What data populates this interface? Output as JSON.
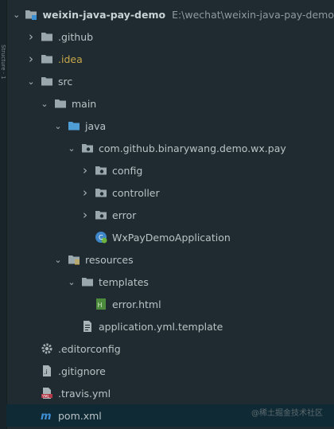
{
  "sidebar": {
    "text": "Structure · 1"
  },
  "tree": [
    {
      "label": "weixin-java-pay-demo",
      "path": "E:\\wechat\\weixin-java-pay-demo",
      "icon": "module-folder-icon",
      "expanded": true,
      "depth": 0,
      "has_arrow": true,
      "bold": true
    },
    {
      "label": ".github",
      "icon": "folder-icon",
      "expanded": false,
      "depth": 1,
      "has_arrow": true
    },
    {
      "label": ".idea",
      "icon": "folder-icon",
      "expanded": false,
      "depth": 1,
      "has_arrow": true,
      "highlight": "yellow"
    },
    {
      "label": "src",
      "icon": "folder-icon",
      "expanded": true,
      "depth": 1,
      "has_arrow": true
    },
    {
      "label": "main",
      "icon": "folder-icon",
      "expanded": true,
      "depth": 2,
      "has_arrow": true
    },
    {
      "label": "java",
      "icon": "source-folder-icon",
      "expanded": true,
      "depth": 3,
      "has_arrow": true
    },
    {
      "label": "com.github.binarywang.demo.wx.pay",
      "icon": "package-icon",
      "expanded": true,
      "depth": 4,
      "has_arrow": true
    },
    {
      "label": "config",
      "icon": "package-icon",
      "expanded": false,
      "depth": 5,
      "has_arrow": true
    },
    {
      "label": "controller",
      "icon": "package-icon",
      "expanded": false,
      "depth": 5,
      "has_arrow": true
    },
    {
      "label": "error",
      "icon": "package-icon",
      "expanded": false,
      "depth": 5,
      "has_arrow": true
    },
    {
      "label": "WxPayDemoApplication",
      "icon": "spring-boot-class-icon",
      "depth": 5,
      "has_arrow": false
    },
    {
      "label": "resources",
      "icon": "resources-folder-icon",
      "expanded": true,
      "depth": 3,
      "has_arrow": true
    },
    {
      "label": "templates",
      "icon": "folder-icon",
      "expanded": true,
      "depth": 4,
      "has_arrow": true
    },
    {
      "label": "error.html",
      "icon": "html-file-icon",
      "depth": 5,
      "has_arrow": false
    },
    {
      "label": "application.yml.template",
      "icon": "text-file-icon",
      "depth": 4,
      "has_arrow": false
    },
    {
      "label": ".editorconfig",
      "icon": "gear-icon",
      "depth": 1,
      "has_arrow": false
    },
    {
      "label": ".gitignore",
      "icon": "gitignore-file-icon",
      "depth": 1,
      "has_arrow": false
    },
    {
      "label": ".travis.yml",
      "icon": "yml-file-icon",
      "depth": 1,
      "has_arrow": false
    },
    {
      "label": "pom.xml",
      "icon": "maven-file-icon",
      "depth": 1,
      "has_arrow": false,
      "selected": true
    }
  ],
  "watermark": "@稀土掘金技术社区",
  "colors": {
    "background": "#1f2b30",
    "selected": "#0f2a34",
    "folder": "#9aa8ad",
    "package": "#9aa8ad",
    "source": "#4f9fd6",
    "yellow_text": "#c8a84a"
  }
}
